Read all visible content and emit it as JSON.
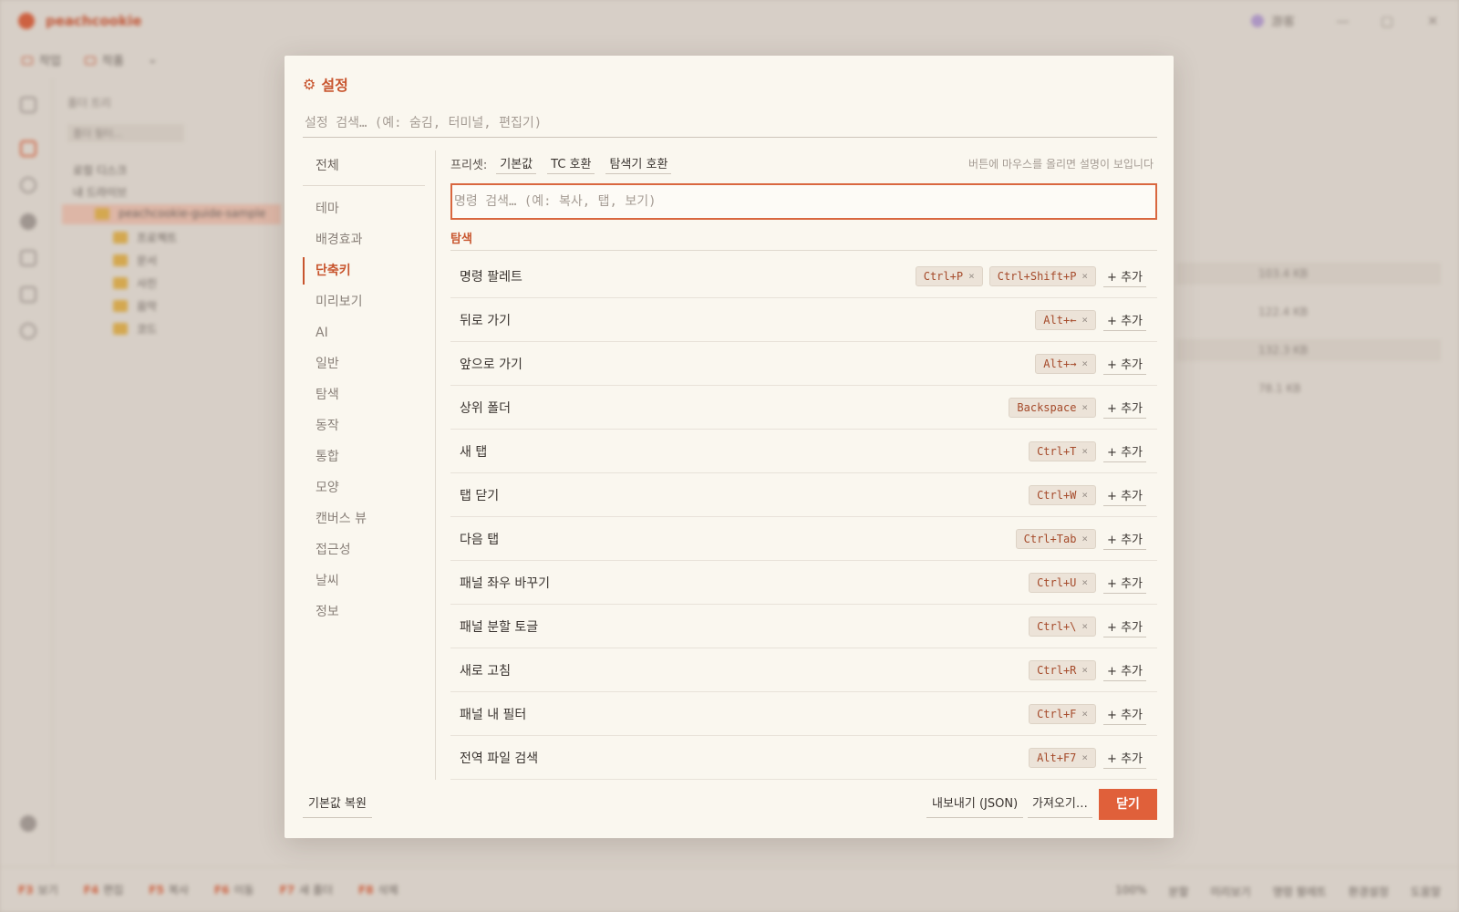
{
  "background": {
    "app_name": "peachcookie",
    "user": "游客",
    "tabs": [
      "작업",
      "작품"
    ],
    "tree_label": "폴더 트리",
    "tree_filter": "폴더 필터...",
    "tree_items": [
      "로컬 디스크",
      "내 드라이브",
      "peachcookie-guide-sample",
      "프로젝트",
      "문서",
      "사진",
      "음악",
      "코드"
    ],
    "file_sizes": [
      "103.4 KB",
      "122.4 KB",
      "132.3 KB",
      "78.1 KB"
    ],
    "status_items": [
      {
        "key": "F3",
        "label": "보기"
      },
      {
        "key": "F4",
        "label": "편집"
      },
      {
        "key": "F5",
        "label": "복사"
      },
      {
        "key": "F6",
        "label": "이동"
      },
      {
        "key": "F7",
        "label": "새 폴더"
      },
      {
        "key": "F8",
        "label": "삭제"
      }
    ],
    "status_right": [
      "100%",
      "분할",
      "미리보기",
      "명령 팔레트",
      "환경설정",
      "도움말"
    ]
  },
  "dialog": {
    "title": "설정",
    "title_icon": "gear-icon",
    "search_placeholder": "설정 검색… (예: 숨김, 터미널, 편집기)",
    "nav": {
      "all": "전체",
      "items": [
        "테마",
        "배경효과",
        "단축키",
        "미리보기",
        "AI",
        "일반",
        "탐색",
        "동작",
        "통합",
        "모양",
        "캔버스 뷰",
        "접근성",
        "날씨",
        "정보"
      ],
      "active": "단축키"
    },
    "preset": {
      "label": "프리셋:",
      "buttons": [
        "기본값",
        "TC 호환",
        "탐색기 호환"
      ],
      "hint": "버튼에 마우스를 올리면 설명이 보입니다"
    },
    "command_search_placeholder": "명령 검색… (예: 복사, 탭, 보기)",
    "section_title": "탐색",
    "add_label": "+ 추가",
    "chip_remove": "×",
    "shortcuts": [
      {
        "label": "명령 팔레트",
        "keys": [
          "Ctrl+P",
          "Ctrl+Shift+P"
        ]
      },
      {
        "label": "뒤로 가기",
        "keys": [
          "Alt+←"
        ]
      },
      {
        "label": "앞으로 가기",
        "keys": [
          "Alt+→"
        ]
      },
      {
        "label": "상위 폴더",
        "keys": [
          "Backspace"
        ]
      },
      {
        "label": "새 탭",
        "keys": [
          "Ctrl+T"
        ]
      },
      {
        "label": "탭 닫기",
        "keys": [
          "Ctrl+W"
        ]
      },
      {
        "label": "다음 탭",
        "keys": [
          "Ctrl+Tab"
        ]
      },
      {
        "label": "패널 좌우 바꾸기",
        "keys": [
          "Ctrl+U"
        ]
      },
      {
        "label": "패널 분할 토글",
        "keys": [
          "Ctrl+\\"
        ]
      },
      {
        "label": "새로 고침",
        "keys": [
          "Ctrl+R"
        ]
      },
      {
        "label": "패널 내 필터",
        "keys": [
          "Ctrl+F"
        ]
      },
      {
        "label": "전역 파일 검색",
        "keys": [
          "Alt+F7"
        ]
      }
    ],
    "footer": {
      "reset": "기본값 복원",
      "export": "내보내기 (JSON)",
      "import": "가져오기…",
      "close": "닫기"
    }
  },
  "colors": {
    "accent": "#e0603a",
    "accent_text": "#c8552e",
    "dialog_bg": "#faf7ef",
    "key_chip_bg": "#ece3d8"
  }
}
